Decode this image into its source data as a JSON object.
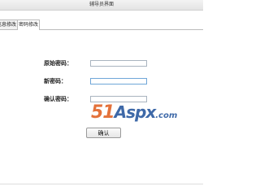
{
  "window": {
    "title": "辅导员界面"
  },
  "tabs": [
    {
      "label": "信息修改"
    },
    {
      "label": "密码修改"
    }
  ],
  "form": {
    "old_password_label": "原始密码：",
    "new_password_label": "新密码：",
    "confirm_password_label": "确认密码：",
    "old_password_value": "",
    "new_password_value": "",
    "confirm_password_value": "",
    "submit_label": "确认"
  },
  "watermark": {
    "number": "51",
    "brand": "Aspx",
    "domain": ".com"
  }
}
